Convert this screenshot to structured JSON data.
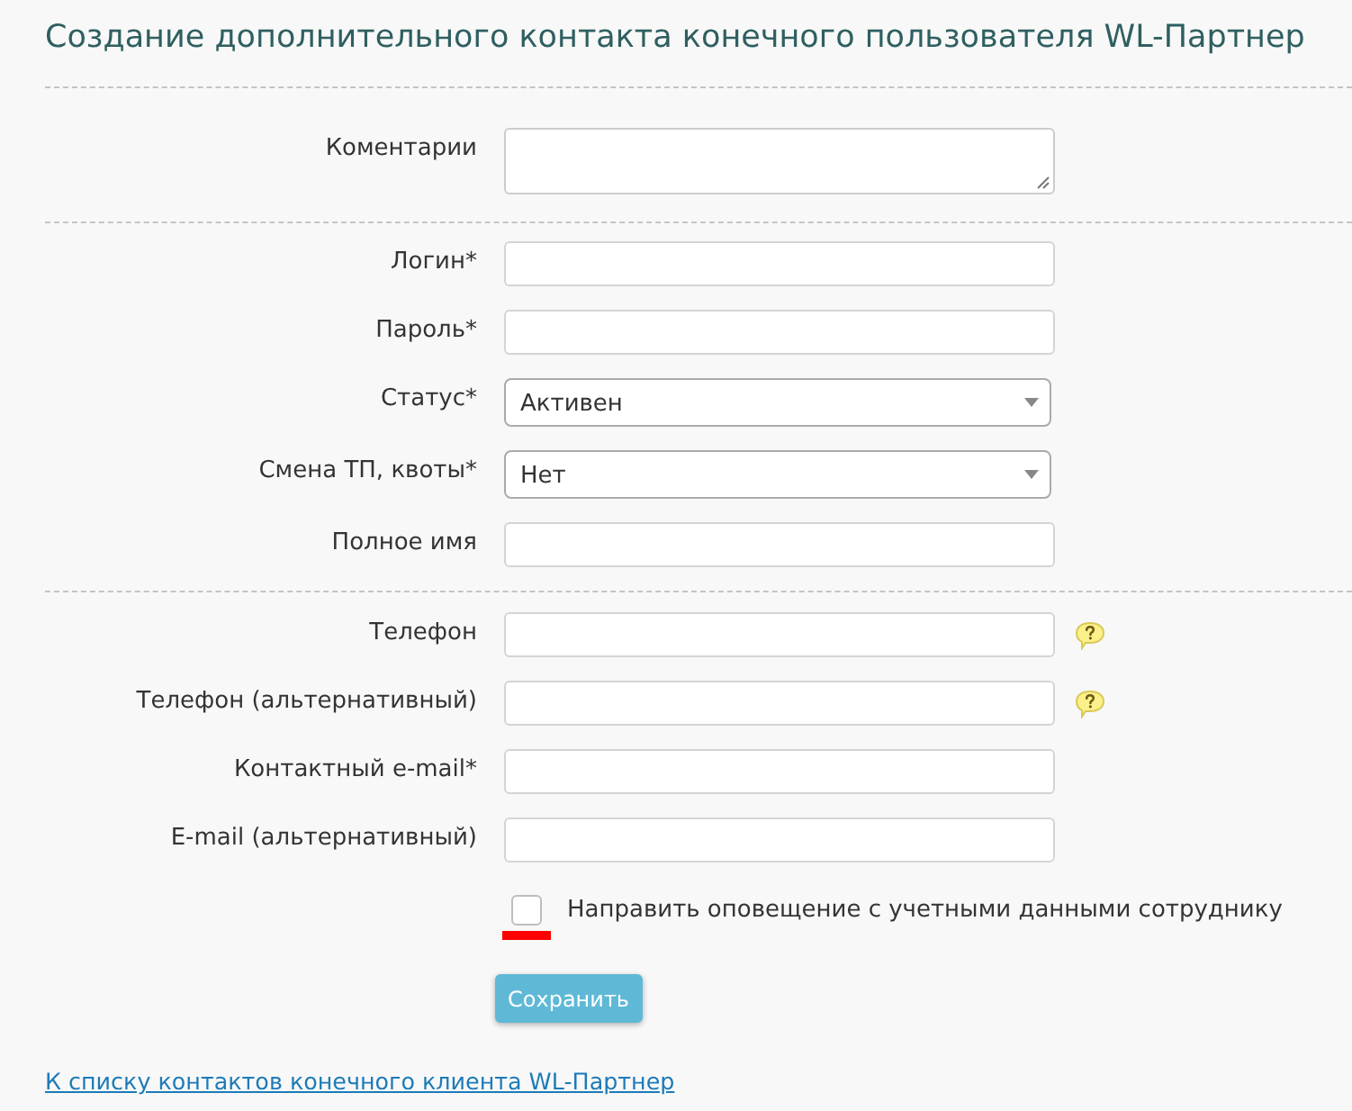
{
  "title": "Создание дополнительного контакта конечного пользователя WL-Партнер",
  "sections": [
    {
      "fields": [
        {
          "kind": "textarea",
          "label": "Коментарии",
          "help": false
        }
      ]
    },
    {
      "fields": [
        {
          "kind": "text",
          "label": "Логин*",
          "help": false
        },
        {
          "kind": "text",
          "label": "Пароль*",
          "help": false
        },
        {
          "kind": "select",
          "label": "Статус*",
          "value": "Активен",
          "help": false
        },
        {
          "kind": "select",
          "label": "Смена ТП, квоты*",
          "value": "Нет",
          "help": false
        },
        {
          "kind": "text",
          "label": "Полное имя",
          "help": false
        }
      ]
    },
    {
      "fields": [
        {
          "kind": "text",
          "label": "Телефон",
          "help": true
        },
        {
          "kind": "text",
          "label": "Телефон (альтернативный)",
          "help": true
        },
        {
          "kind": "text",
          "label": "Контактный e-mail*",
          "help": false
        },
        {
          "kind": "text",
          "label": "E-mail (альтернативный)",
          "help": false
        }
      ]
    }
  ],
  "notify": {
    "label": "Направить оповещение с учетными данными сотруднику",
    "checked": false,
    "underlined": true
  },
  "save_button": "Сохранить",
  "back_link": "К списку контактов конечного клиента WL-Партнер"
}
